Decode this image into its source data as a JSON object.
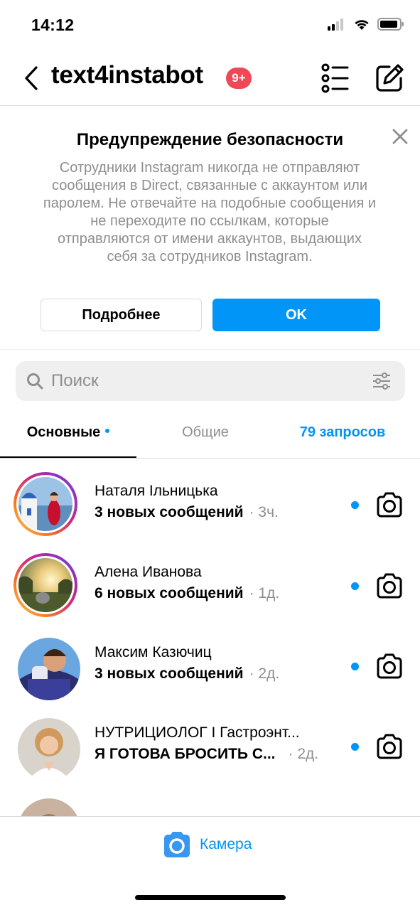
{
  "status_bar": {
    "time": "14:12"
  },
  "header": {
    "title": "text4instabot",
    "badge": "9+"
  },
  "warning": {
    "title": "Предупреждение безопасности",
    "text": "Сотрудники Instagram никогда не отправляют сообщения в Direct, связанные с аккаунтом или паролем. Не отвечайте на подобные сообщения и не переходите по ссылкам, которые отправляются от имени аккаунтов, выдающих себя за сотрудников Instagram.",
    "more_label": "Подробнее",
    "ok_label": "OK"
  },
  "search": {
    "placeholder": "Поиск"
  },
  "tabs": [
    {
      "label": "Основные",
      "active": true,
      "has_dot": true
    },
    {
      "label": "Общие",
      "active": false
    },
    {
      "label": "79 запросов",
      "active": false
    }
  ],
  "threads": [
    {
      "name": "Наталя Ільницька",
      "message": "3 новых сообщений",
      "time": "· 3ч.",
      "unread": true,
      "story_ring": true
    },
    {
      "name": "Алена Иванова",
      "message": "6 новых сообщений",
      "time": "· 1д.",
      "unread": true,
      "story_ring": true
    },
    {
      "name": "Максим Казючиц",
      "message": "3 новых сообщений",
      "time": "· 2д.",
      "unread": true,
      "story_ring": false
    },
    {
      "name": "НУТРИЦИОЛОГ I Гастроэнт...",
      "message": "Я ГОТОВА БРОСИТЬ С...",
      "time": "· 2д.",
      "unread": true,
      "story_ring": false
    }
  ],
  "bottom_bar": {
    "camera_label": "Камера"
  },
  "colors": {
    "accent": "#0095f6",
    "badge": "#ed4956",
    "secondary_text": "#8e8e8e"
  }
}
